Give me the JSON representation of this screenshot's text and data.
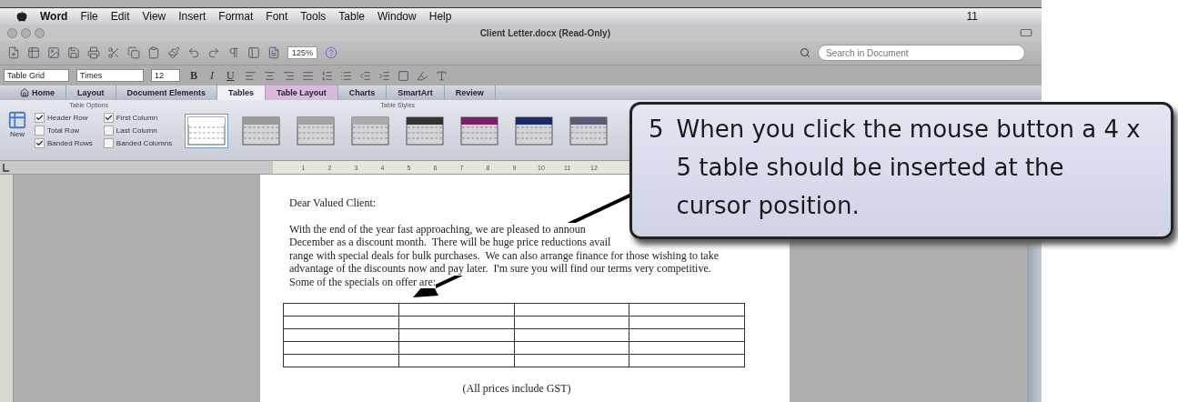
{
  "menu_bar": {
    "items": [
      "Word",
      "File",
      "Edit",
      "View",
      "Insert",
      "Format",
      "Font",
      "Tools",
      "Table",
      "Window",
      "Help"
    ],
    "status_text": "11"
  },
  "window": {
    "title": "Client Letter.docx (Read-Only)"
  },
  "toolbar": {
    "zoom": "125%",
    "search": {
      "placeholder": "Search in Document"
    }
  },
  "format_bar": {
    "style": "Table Grid",
    "font": "Times",
    "size": "12",
    "buttons": [
      "B",
      "I",
      "U"
    ]
  },
  "ribbon": {
    "tabs": [
      {
        "label": "Home",
        "selected": false,
        "contextual": false
      },
      {
        "label": "Layout",
        "selected": false,
        "contextual": false
      },
      {
        "label": "Document Elements",
        "selected": false,
        "contextual": false
      },
      {
        "label": "Tables",
        "selected": true,
        "contextual": false
      },
      {
        "label": "Table Layout",
        "selected": false,
        "contextual": true
      },
      {
        "label": "Charts",
        "selected": false,
        "contextual": false
      },
      {
        "label": "SmartArt",
        "selected": false,
        "contextual": false
      },
      {
        "label": "Review",
        "selected": false,
        "contextual": false
      }
    ],
    "table_options": {
      "title": "Table Options",
      "new_label": "New",
      "options": [
        {
          "label": "Header Row",
          "checked": true
        },
        {
          "label": "Total Row",
          "checked": false
        },
        {
          "label": "Banded Rows",
          "checked": true
        },
        {
          "label": "First Column",
          "checked": true
        },
        {
          "label": "Last Column",
          "checked": false
        },
        {
          "label": "Banded Columns",
          "checked": false
        }
      ]
    },
    "table_styles": {
      "title": "Table Styles",
      "styles": [
        {
          "selected": true,
          "color": "#ffffff"
        },
        {
          "selected": false,
          "color": "#9a9a9a"
        },
        {
          "selected": false,
          "color": "#a4a4a4"
        },
        {
          "selected": false,
          "color": "#aaaaaa"
        },
        {
          "selected": false,
          "color": "#333333"
        },
        {
          "selected": false,
          "color": "#7a1f6a"
        },
        {
          "selected": false,
          "color": "#1a2a6a"
        },
        {
          "selected": false,
          "color": "#5a5a7a"
        }
      ]
    }
  },
  "ruler": {
    "marks": [
      "1",
      "2",
      "3",
      "4",
      "5",
      "6",
      "7",
      "8",
      "9",
      "10",
      "11",
      "12"
    ]
  },
  "document": {
    "greeting": "Dear Valued Client:",
    "paragraph_lines": [
      "With the end of the year fast approaching, we are pleased to announ",
      "December as a discount month.  There will be huge price reductions avail",
      "range with special deals for bulk purchases.  We can also arrange finance for those wishing to take",
      "advantage of the discounts now and pay later.  I'm sure you will find our terms very competitive.",
      "Some of the specials on offer are:"
    ],
    "caption": "(All prices include GST)"
  },
  "callout": {
    "number": "5",
    "text": "When you click the mouse button a 4 x 5 table should be inserted at the cursor position."
  }
}
